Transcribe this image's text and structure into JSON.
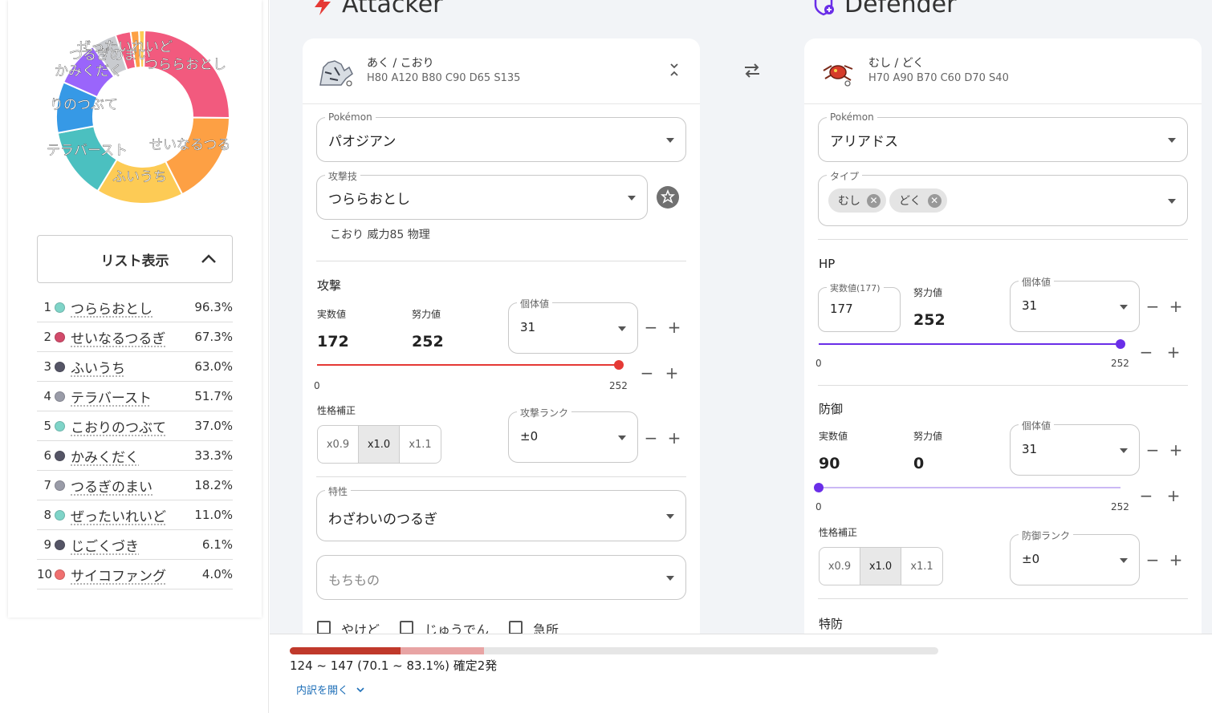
{
  "donut": {
    "segments": [
      {
        "label": "つららおとし",
        "value": 96.3,
        "color": "#f25a7e"
      },
      {
        "label": "せいなるつるぎ",
        "value": 67.3,
        "color": "#fda044"
      },
      {
        "label": "ふいうち",
        "value": 63.0,
        "color": "#fdcb55"
      },
      {
        "label": "テラバースト",
        "value": 51.7,
        "color": "#4bc0c0"
      },
      {
        "label": "こおりのつぶて",
        "value": 37.0,
        "color": "#3699e6"
      },
      {
        "label": "かみくだく",
        "value": 33.3,
        "color": "#9a65fb"
      },
      {
        "label": "つるぎのまい",
        "value": 18.2,
        "color": "#c9cbcf"
      },
      {
        "label": "ぜったいれいど",
        "value": 11.0,
        "color": "#f25a7e"
      },
      {
        "label": "じごくづき",
        "value": 6.1,
        "color": "#fda044"
      },
      {
        "label": "サイコファング",
        "value": 4.0,
        "color": "#fdcb55"
      }
    ],
    "visible_labels": [
      "ぜったいれいど",
      "つるぎのまい",
      "かみくだく",
      "つららおとし",
      "りのつぶて",
      "テラバースト",
      "せいなるつる",
      "ふいうち"
    ]
  },
  "list_toggle": {
    "label": "リスト表示"
  },
  "moves_list": [
    {
      "rank": "1",
      "name": "つららおとし",
      "pct": "96.3%",
      "color": "#7fd4c8"
    },
    {
      "rank": "2",
      "name": "せいなるつるぎ",
      "pct": "67.3%",
      "color": "#d24a6a"
    },
    {
      "rank": "3",
      "name": "ふいうち",
      "pct": "63.0%",
      "color": "#555566"
    },
    {
      "rank": "4",
      "name": "テラバースト",
      "pct": "51.7%",
      "color": "#9a9ca8"
    },
    {
      "rank": "5",
      "name": "こおりのつぶて",
      "pct": "37.0%",
      "color": "#7fd4c8"
    },
    {
      "rank": "6",
      "name": "かみくだく",
      "pct": "33.3%",
      "color": "#555566"
    },
    {
      "rank": "7",
      "name": "つるぎのまい",
      "pct": "18.2%",
      "color": "#9a9ca8"
    },
    {
      "rank": "8",
      "name": "ぜったいれいど",
      "pct": "11.0%",
      "color": "#7fd4c8"
    },
    {
      "rank": "9",
      "name": "じごくづき",
      "pct": "6.1%",
      "color": "#555566"
    },
    {
      "rank": "10",
      "name": "サイコファング",
      "pct": "4.0%",
      "color": "#f07070"
    }
  ],
  "attacker": {
    "title": "Attacker",
    "types": "あく / こおり",
    "stats": "H80 A120 B80 C90 D65 S135",
    "pokemon_label": "Pokémon",
    "pokemon": "パオジアン",
    "move_label": "攻撃技",
    "move": "つららおとし",
    "move_info": "こおり 威力85 物理",
    "stat_heading": "攻撃",
    "actual_label": "実数値",
    "actual": "172",
    "ev_label": "努力値",
    "ev": "252",
    "iv_label": "個体値",
    "iv": "31",
    "ev_fraction": 1.0,
    "slider_min": "0",
    "slider_max": "252",
    "nature_label": "性格補正",
    "nature_options": [
      "x0.9",
      "x1.0",
      "x1.1"
    ],
    "rank_label": "攻撃ランク",
    "rank": "±0",
    "ability_label": "特性",
    "ability": "わざわいのつるぎ",
    "item_placeholder": "もちもの",
    "burn": "やけど",
    "charge": "じゅうでん",
    "crit": "急所"
  },
  "defender": {
    "title": "Defender",
    "types": "むし / どく",
    "stats": "H70 A90 B70 C60 D70 S40",
    "pokemon_label": "Pokémon",
    "pokemon": "アリアドス",
    "type_label": "タイプ",
    "type_chips": [
      "むし",
      "どく"
    ],
    "hp_heading": "HP",
    "hp_actual_label": "実数値(177)",
    "hp_actual": "177",
    "hp_ev_label": "努力値",
    "hp_ev": "252",
    "hp_iv_label": "個体値",
    "hp_iv": "31",
    "hp_ev_fraction": 1.0,
    "hp_min": "0",
    "hp_max": "252",
    "def_heading": "防御",
    "def_actual_label": "実数値",
    "def_actual": "90",
    "def_ev_label": "努力値",
    "def_ev": "0",
    "def_iv_label": "個体値",
    "def_iv": "31",
    "def_ev_fraction": 0.0,
    "def_min": "0",
    "def_max": "252",
    "nature_label": "性格補正",
    "nature_options": [
      "x0.9",
      "x1.0",
      "x1.1"
    ],
    "rank_label": "防御ランク",
    "rank": "±0",
    "spdef_heading": "特防"
  },
  "swap": {
    "icon": "swap-arrows-icon"
  },
  "result": {
    "text": "124 ~ 147 (70.1 ~ 83.1%) 確定2発",
    "min_fraction": 0.171,
    "max_fraction": 0.3,
    "breakdown": "内訳を開く"
  },
  "colors": {
    "attack_slider": "#e53935",
    "def_slider": "#6a2ee8",
    "accent_red": "#e53935"
  }
}
